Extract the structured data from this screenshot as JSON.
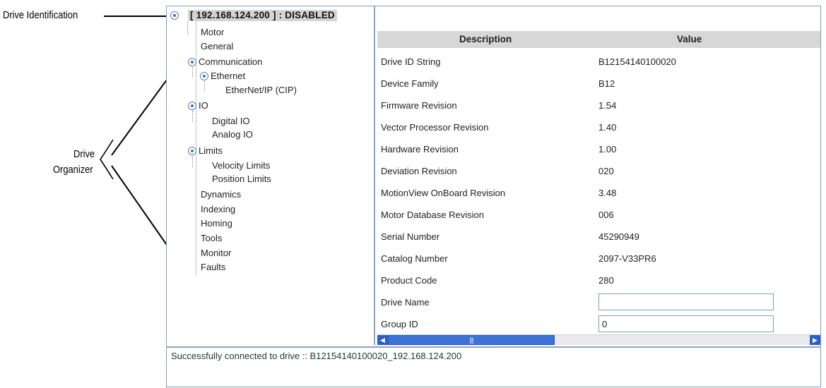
{
  "callouts": {
    "drive_identification": "Drive Identification",
    "drive_organizer_line1": "Drive",
    "drive_organizer_line2": "Organizer"
  },
  "tree": {
    "root": "[ 192.168.124.200 ]  : DISABLED",
    "items": {
      "motor": "Motor",
      "general": "General",
      "communication": "Communication",
      "ethernet": "Ethernet",
      "ethernet_ip": "EtherNet/IP (CIP)",
      "io": "IO",
      "digital_io": "Digital IO",
      "analog_io": "Analog IO",
      "limits": "Limits",
      "velocity_limits": "Velocity Limits",
      "position_limits": "Position Limits",
      "dynamics": "Dynamics",
      "indexing": "Indexing",
      "homing": "Homing",
      "tools": "Tools",
      "monitor": "Monitor",
      "faults": "Faults"
    }
  },
  "table": {
    "headers": {
      "description": "Description",
      "value": "Value"
    },
    "rows": [
      {
        "description": "Drive ID String",
        "value": "B12154140100020"
      },
      {
        "description": "Device Family",
        "value": "B12"
      },
      {
        "description": "Firmware Revision",
        "value": "1.54"
      },
      {
        "description": "Vector Processor Revision",
        "value": "1.40"
      },
      {
        "description": "Hardware Revision",
        "value": "1.00"
      },
      {
        "description": "Deviation Revision",
        "value": "020"
      },
      {
        "description": "MotionView OnBoard Revision",
        "value": "3.48"
      },
      {
        "description": "Motor Database Revision",
        "value": "006"
      },
      {
        "description": "Serial Number",
        "value": "45290949"
      },
      {
        "description": "Catalog Number",
        "value": "2097-V33PR6"
      },
      {
        "description": "Product Code",
        "value": "280"
      }
    ],
    "editable_rows": [
      {
        "description": "Drive Name",
        "value": ""
      },
      {
        "description": "Group ID",
        "value": "0"
      }
    ]
  },
  "scrollbar": {
    "thumb_grip": "||||"
  },
  "status": {
    "message": "Successfully connected to drive ::  B12154140100020_192.168.124.200"
  }
}
